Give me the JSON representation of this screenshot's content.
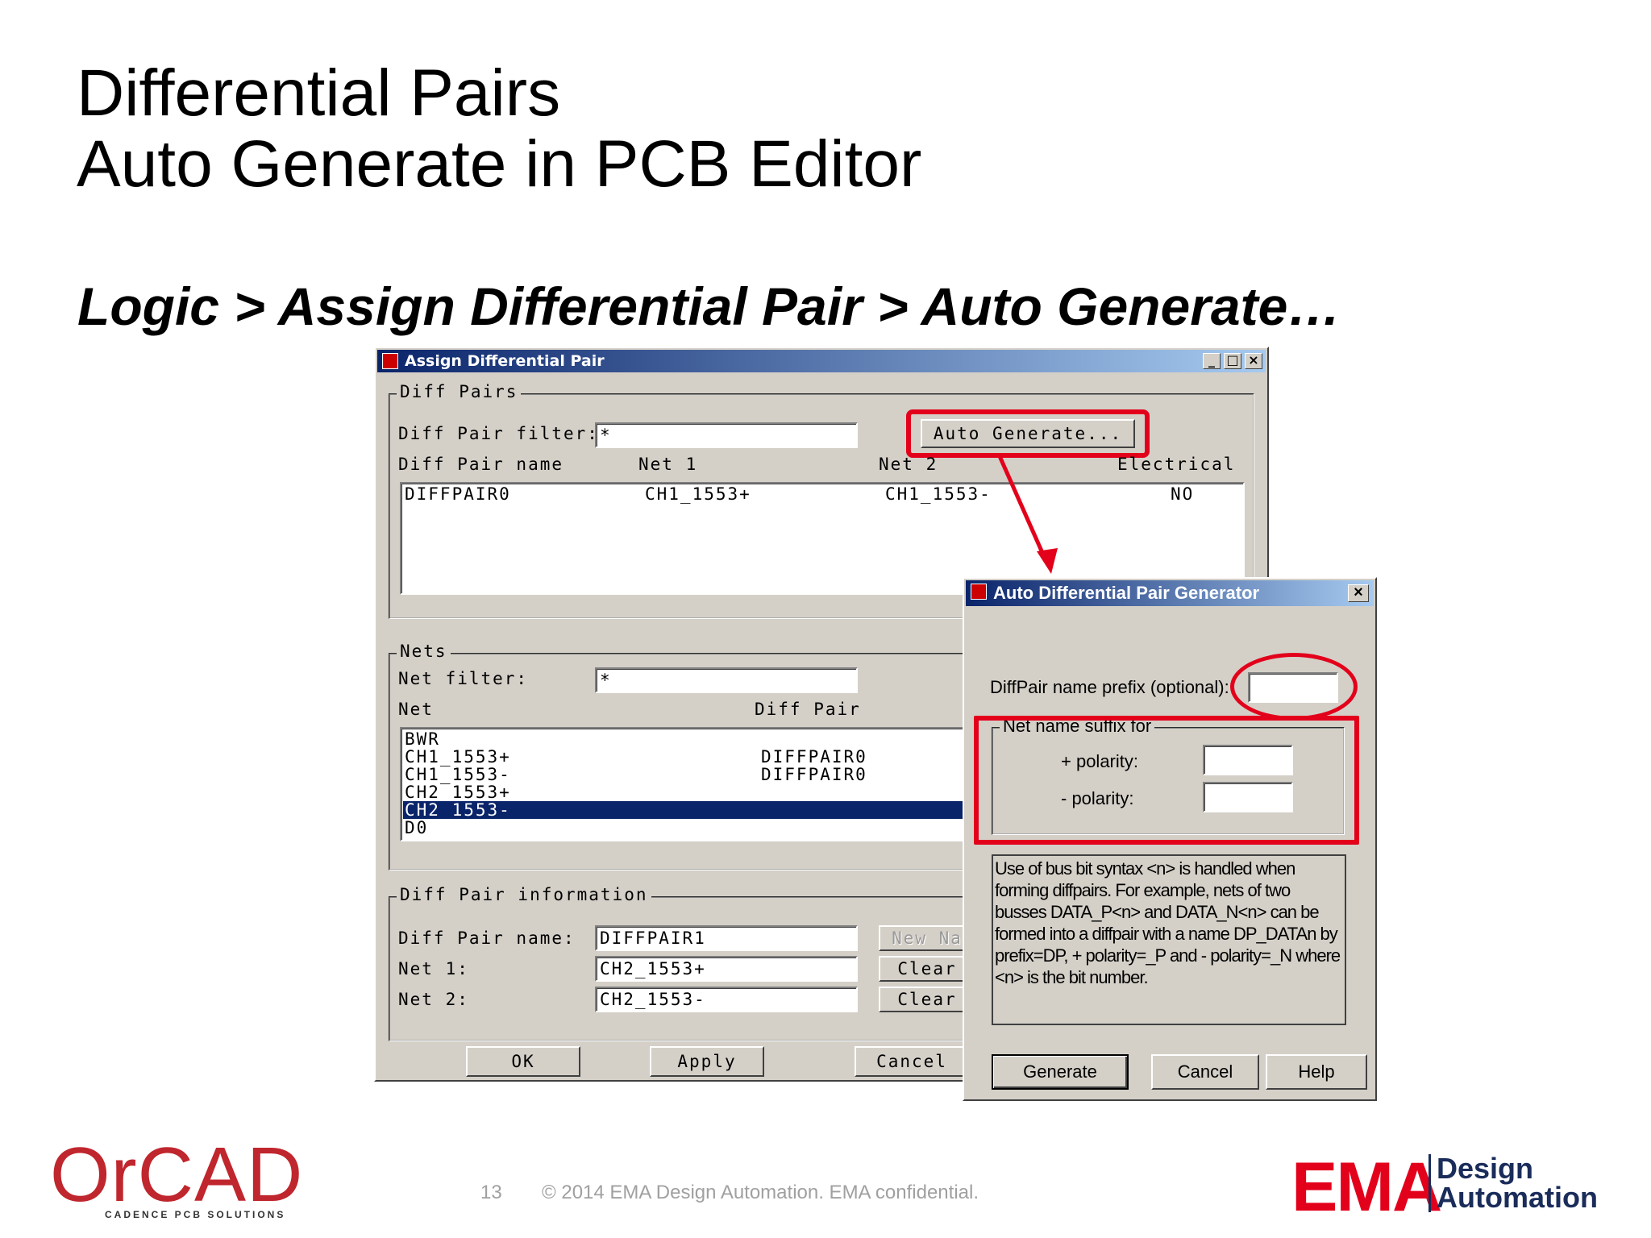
{
  "slide": {
    "title_line1": "Differential Pairs",
    "title_line2": "Auto Generate in PCB Editor",
    "subtitle": "Logic > Assign Differential Pair > Auto Generate…",
    "page_number": "13",
    "copyright": "© 2014 EMA Design Automation. EMA confidential.",
    "logo_left": "OrCAD",
    "logo_left_tagline": "CADENCE PCB SOLUTIONS",
    "logo_right_mark": "EMA",
    "logo_right_line1": "Design",
    "logo_right_line2": "Automation"
  },
  "assign_dialog": {
    "title": "Assign Differential Pair",
    "group_diff_pairs": "Diff Pairs",
    "filter_label": "Diff Pair filter:",
    "filter_value": "*",
    "auto_generate_button": "Auto Generate...",
    "columns": [
      "Diff Pair name",
      "Net 1",
      "Net 2",
      "Electrical"
    ],
    "pairs": [
      {
        "name": "DIFFPAIR0",
        "net1": "CH1_1553+",
        "net2": "CH1_1553-",
        "electrical": "NO"
      }
    ],
    "group_nets": "Nets",
    "net_filter_label": "Net filter:",
    "net_filter_value": "*",
    "net_col": "Net",
    "diffpair_col": "Diff Pair",
    "nets": [
      {
        "net": "BWR",
        "pair": ""
      },
      {
        "net": "CH1_1553+",
        "pair": "DIFFPAIR0"
      },
      {
        "net": "CH1_1553-",
        "pair": "DIFFPAIR0"
      },
      {
        "net": "CH2_1553+",
        "pair": ""
      },
      {
        "net": "CH2_1553-",
        "pair": ""
      },
      {
        "net": "D0",
        "pair": ""
      }
    ],
    "group_info": "Diff Pair information",
    "info_name_label": "Diff Pair name:",
    "info_name_value": "DIFFPAIR1",
    "info_net1_label": "Net 1:",
    "info_net1_value": "CH2_1553+",
    "info_net2_label": "Net 2:",
    "info_net2_value": "CH2_1553-",
    "new_name_button": "New Na",
    "clear1_button": "Clear",
    "clear2_button": "Clear",
    "ok_button": "OK",
    "apply_button": "Apply",
    "cancel_button": "Cancel"
  },
  "auto_dialog": {
    "title": "Auto Differential Pair Generator",
    "prefix_label": "DiffPair name prefix (optional):",
    "prefix_value": "",
    "suffix_group": "Net name suffix for",
    "plus_label": "+ polarity:",
    "plus_value": "",
    "minus_label": "- polarity:",
    "minus_value": "",
    "help_text": "Use of bus bit syntax <n> is handled when forming diffpairs. For example, nets of two busses DATA_P<n> and DATA_N<n> can be formed into a diffpair with a name DP_DATAn by prefix=DP, + polarity=_P and - polarity=_N where <n> is the bit number.",
    "generate_button": "Generate",
    "cancel_button": "Cancel",
    "help_button": "Help"
  },
  "colors": {
    "highlight_red": "#e3001b",
    "titlebar_blue": "#0a246a",
    "dialog_gray": "#d4d0c8"
  }
}
